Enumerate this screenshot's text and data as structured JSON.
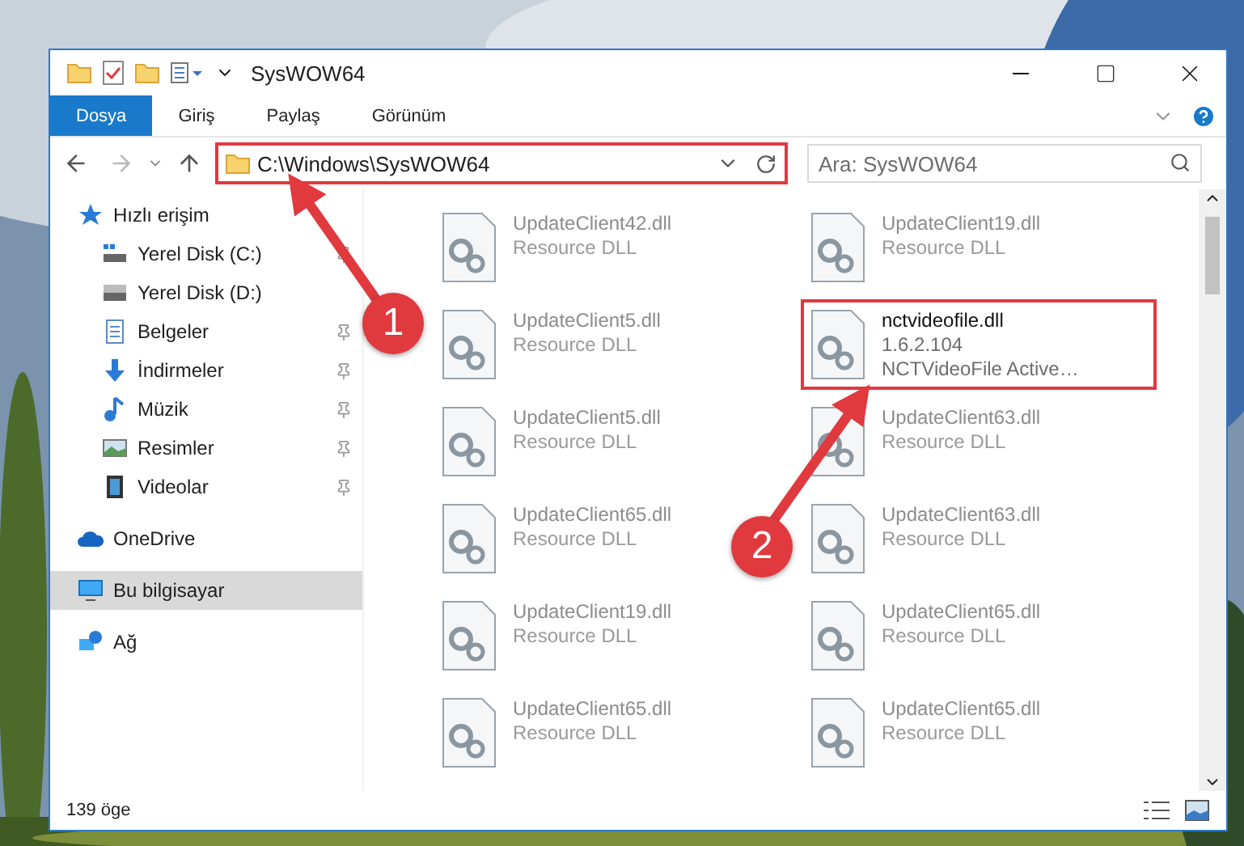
{
  "window": {
    "title": "SysWOW64"
  },
  "ribbon": {
    "tabs": [
      {
        "label": "Dosya",
        "selected": true
      },
      {
        "label": "Giriş",
        "selected": false
      },
      {
        "label": "Paylaş",
        "selected": false
      },
      {
        "label": "Görünüm",
        "selected": false
      }
    ]
  },
  "address_bar": {
    "path": "C:\\Windows\\SysWOW64",
    "highlighted": true
  },
  "search": {
    "placeholder": "Ara: SysWOW64"
  },
  "sidebar": {
    "items": [
      {
        "label": "Hızlı erişim",
        "selected": false,
        "children": [
          {
            "label": "Yerel Disk (C:)",
            "pinned": true,
            "selected": false
          },
          {
            "label": "Yerel Disk (D:)",
            "pinned": false,
            "selected": false
          },
          {
            "label": "Belgeler",
            "pinned": true,
            "selected": false
          },
          {
            "label": "İndirmeler",
            "pinned": true,
            "selected": false
          },
          {
            "label": "Müzik",
            "pinned": true,
            "selected": false
          },
          {
            "label": "Resimler",
            "pinned": true,
            "selected": false
          },
          {
            "label": "Videolar",
            "pinned": true,
            "selected": false
          }
        ]
      },
      {
        "label": "OneDrive",
        "selected": false
      },
      {
        "label": "Bu bilgisayar",
        "selected": true
      },
      {
        "label": "Ağ",
        "selected": false
      }
    ]
  },
  "files": [
    {
      "name": "UpdateClient42.dll",
      "details": [
        "Resource DLL"
      ],
      "blurred": true,
      "highlighted": false
    },
    {
      "name": "UpdateClient19.dll",
      "details": [
        "Resource DLL"
      ],
      "blurred": true,
      "highlighted": false
    },
    {
      "name": "UpdateClient5.dll",
      "details": [
        "Resource DLL"
      ],
      "blurred": true,
      "highlighted": false
    },
    {
      "name": "nctvideofile.dll",
      "details": [
        "1.6.2.104",
        "NCTVideoFile Active…"
      ],
      "blurred": false,
      "highlighted": true
    },
    {
      "name": "UpdateClient5.dll",
      "details": [
        "Resource DLL"
      ],
      "blurred": true,
      "highlighted": false
    },
    {
      "name": "UpdateClient63.dll",
      "details": [
        "Resource DLL"
      ],
      "blurred": true,
      "highlighted": false
    },
    {
      "name": "UpdateClient65.dll",
      "details": [
        "Resource DLL"
      ],
      "blurred": true,
      "highlighted": false
    },
    {
      "name": "UpdateClient63.dll",
      "details": [
        "Resource DLL"
      ],
      "blurred": true,
      "highlighted": false
    },
    {
      "name": "UpdateClient19.dll",
      "details": [
        "Resource DLL"
      ],
      "blurred": true,
      "highlighted": false
    },
    {
      "name": "UpdateClient65.dll",
      "details": [
        "Resource DLL"
      ],
      "blurred": true,
      "highlighted": false
    },
    {
      "name": "UpdateClient65.dll",
      "details": [
        "Resource DLL"
      ],
      "blurred": true,
      "highlighted": false
    },
    {
      "name": "UpdateClient65.dll",
      "details": [
        "Resource DLL"
      ],
      "blurred": true,
      "highlighted": false
    }
  ],
  "status_bar": {
    "count": "139 öge"
  },
  "annotations": [
    {
      "label": "1"
    },
    {
      "label": "2"
    }
  ]
}
